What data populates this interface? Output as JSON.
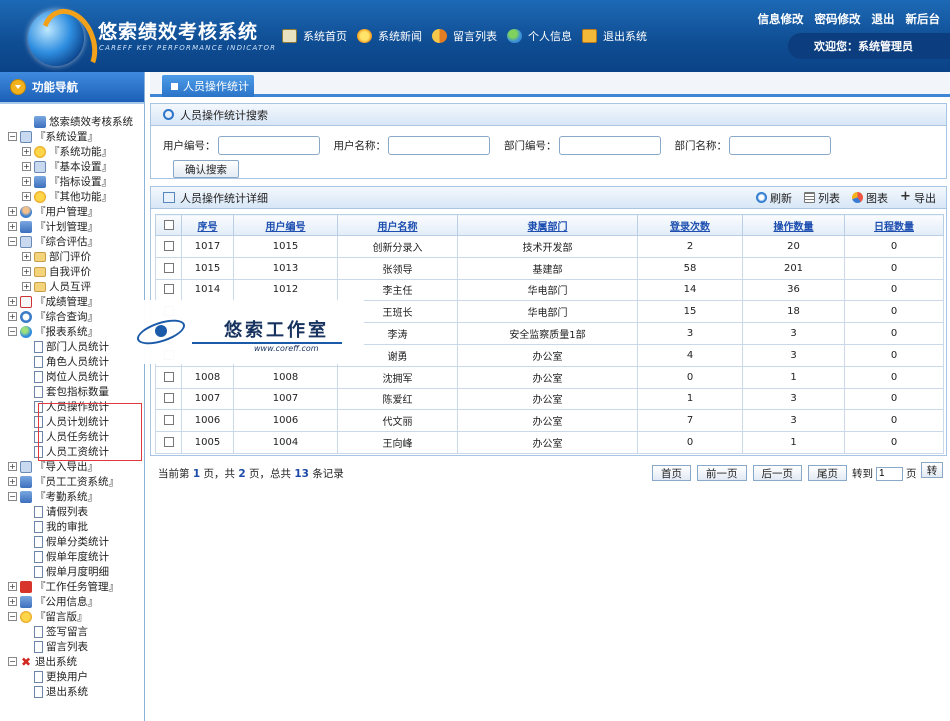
{
  "header": {
    "title": "悠索绩效考核系统",
    "subtitle": "CAREFF KEY PERFORMANCE INDICATOR",
    "nav": [
      {
        "label": "系统首页",
        "icon": "home-icon"
      },
      {
        "label": "系统新闻",
        "icon": "news-icon"
      },
      {
        "label": "留言列表",
        "icon": "message-icon"
      },
      {
        "label": "个人信息",
        "icon": "user-icon"
      },
      {
        "label": "退出系统",
        "icon": "exit-icon"
      }
    ],
    "links": [
      "信息修改",
      "密码修改",
      "退出",
      "新后台"
    ],
    "welcome": "欢迎您：系统管理员"
  },
  "sidebar": {
    "title": "功能导航",
    "highlight_color": "#e0383c",
    "tree": [
      {
        "label": "悠索绩效考核系统",
        "level": 1,
        "pm": "",
        "icon": "t-comp"
      },
      {
        "label": "『系统设置』",
        "level": 0,
        "pm": "−",
        "icon": "t-grid"
      },
      {
        "label": "『系统功能』",
        "level": 1,
        "pm": "+",
        "icon": "t-star"
      },
      {
        "label": "『基本设置』",
        "level": 1,
        "pm": "+",
        "icon": "t-grid"
      },
      {
        "label": "『指标设置』",
        "level": 1,
        "pm": "+",
        "icon": "t-comp"
      },
      {
        "label": "『其他功能』",
        "level": 1,
        "pm": "+",
        "icon": "t-star"
      },
      {
        "label": "『用户管理』",
        "level": 0,
        "pm": "+",
        "icon": "t-user"
      },
      {
        "label": "『计划管理』",
        "level": 0,
        "pm": "+",
        "icon": "t-comp"
      },
      {
        "label": "『综合评估』",
        "level": 0,
        "pm": "−",
        "icon": "t-grid"
      },
      {
        "label": "部门评价",
        "level": 1,
        "pm": "+",
        "icon": "t-folder"
      },
      {
        "label": "自我评价",
        "level": 1,
        "pm": "+",
        "icon": "t-folder"
      },
      {
        "label": "人员互评",
        "level": 1,
        "pm": "+",
        "icon": "t-folder"
      },
      {
        "label": "『成绩管理』",
        "level": 0,
        "pm": "+",
        "icon": "t-cal"
      },
      {
        "label": "『综合查询』",
        "level": 0,
        "pm": "+",
        "icon": "t-mag"
      },
      {
        "label": "『报表系统』",
        "level": 0,
        "pm": "−",
        "icon": "t-globe"
      },
      {
        "label": "部门人员统计",
        "level": 1,
        "pm": "",
        "icon": "t-doc"
      },
      {
        "label": "角色人员统计",
        "level": 1,
        "pm": "",
        "icon": "t-doc"
      },
      {
        "label": "岗位人员统计",
        "level": 1,
        "pm": "",
        "icon": "t-doc"
      },
      {
        "label": "套包指标数量",
        "level": 1,
        "pm": "",
        "icon": "t-doc"
      },
      {
        "label": "人员操作统计",
        "level": 1,
        "pm": "",
        "icon": "t-doc"
      },
      {
        "label": "人员计划统计",
        "level": 1,
        "pm": "",
        "icon": "t-doc"
      },
      {
        "label": "人员任务统计",
        "level": 1,
        "pm": "",
        "icon": "t-doc"
      },
      {
        "label": "人员工资统计",
        "level": 1,
        "pm": "",
        "icon": "t-doc"
      },
      {
        "label": "『导入导出』",
        "level": 0,
        "pm": "+",
        "icon": "t-grid"
      },
      {
        "label": "『员工工资系统』",
        "level": 0,
        "pm": "+",
        "icon": "t-comp"
      },
      {
        "label": "『考勤系统』",
        "level": 0,
        "pm": "−",
        "icon": "t-comp"
      },
      {
        "label": "请假列表",
        "level": 1,
        "pm": "",
        "icon": "t-doc"
      },
      {
        "label": "我的审批",
        "level": 1,
        "pm": "",
        "icon": "t-doc"
      },
      {
        "label": "假单分类统计",
        "level": 1,
        "pm": "",
        "icon": "t-doc"
      },
      {
        "label": "假单年度统计",
        "level": 1,
        "pm": "",
        "icon": "t-doc"
      },
      {
        "label": "假单月度明细",
        "level": 1,
        "pm": "",
        "icon": "t-doc"
      },
      {
        "label": "『工作任务管理』",
        "level": 0,
        "pm": "+",
        "icon": "t-red"
      },
      {
        "label": "『公用信息』",
        "level": 0,
        "pm": "+",
        "icon": "t-comp"
      },
      {
        "label": "『留言版』",
        "level": 0,
        "pm": "−",
        "icon": "t-star"
      },
      {
        "label": "签写留言",
        "level": 1,
        "pm": "",
        "icon": "t-doc"
      },
      {
        "label": "留言列表",
        "level": 1,
        "pm": "",
        "icon": "t-doc"
      },
      {
        "label": "退出系统",
        "level": 0,
        "pm": "−",
        "icon": "t-x"
      },
      {
        "label": "更换用户",
        "level": 1,
        "pm": "",
        "icon": "t-doc"
      },
      {
        "label": "退出系统",
        "level": 1,
        "pm": "",
        "icon": "t-doc"
      }
    ]
  },
  "main": {
    "tab": "人员操作统计",
    "search": {
      "title": "人员操作统计搜索",
      "fields": [
        {
          "label": "用户编号：",
          "value": ""
        },
        {
          "label": "用户名称：",
          "value": ""
        },
        {
          "label": "部门编号：",
          "value": ""
        },
        {
          "label": "部门名称：",
          "value": ""
        }
      ],
      "button": "确认搜索"
    },
    "detail": {
      "title": "人员操作统计详细",
      "actions": [
        {
          "label": "刷新",
          "icon": "refresh-icon"
        },
        {
          "label": "列表",
          "icon": "list-icon"
        },
        {
          "label": "图表",
          "icon": "chart-icon"
        },
        {
          "label": "导出",
          "icon": "export-icon"
        }
      ],
      "columns": [
        "序号",
        "用户编号",
        "用户名称",
        "隶属部门",
        "登录次数",
        "操作数量",
        "日程数量"
      ],
      "rows": [
        [
          "1017",
          "1015",
          "创新分录入",
          "技术开发部",
          "2",
          "20",
          "0"
        ],
        [
          "1015",
          "1013",
          "张领导",
          "基建部",
          "58",
          "201",
          "0"
        ],
        [
          "1014",
          "1012",
          "李主任",
          "华电部门",
          "14",
          "36",
          "0"
        ],
        [
          "",
          "",
          "王班长",
          "华电部门",
          "15",
          "18",
          "0"
        ],
        [
          "",
          "",
          "李涛",
          "安全监察质量1部",
          "3",
          "3",
          "0"
        ],
        [
          "",
          "",
          "谢勇",
          "办公室",
          "4",
          "3",
          "0"
        ],
        [
          "1008",
          "1008",
          "沈拥军",
          "办公室",
          "0",
          "1",
          "0"
        ],
        [
          "1007",
          "1007",
          "陈爱红",
          "办公室",
          "1",
          "3",
          "0"
        ],
        [
          "1006",
          "1006",
          "代文丽",
          "办公室",
          "7",
          "3",
          "0"
        ],
        [
          "1005",
          "1004",
          "王向峰",
          "办公室",
          "0",
          "1",
          "0"
        ]
      ]
    },
    "pager": {
      "prefix": "当前第",
      "current": "1",
      "mid1": "页，共",
      "total_pages": "2",
      "mid2": "页，总共",
      "total_records": "13",
      "suffix": "条记录",
      "buttons": [
        "首页",
        "前一页",
        "后一页",
        "尾页"
      ],
      "goto_label": "转到",
      "goto_value": "1",
      "goto_unit": "页",
      "go_button": "转"
    }
  },
  "watermark": {
    "text": "悠索工作室",
    "url": "www.coreff.com"
  }
}
